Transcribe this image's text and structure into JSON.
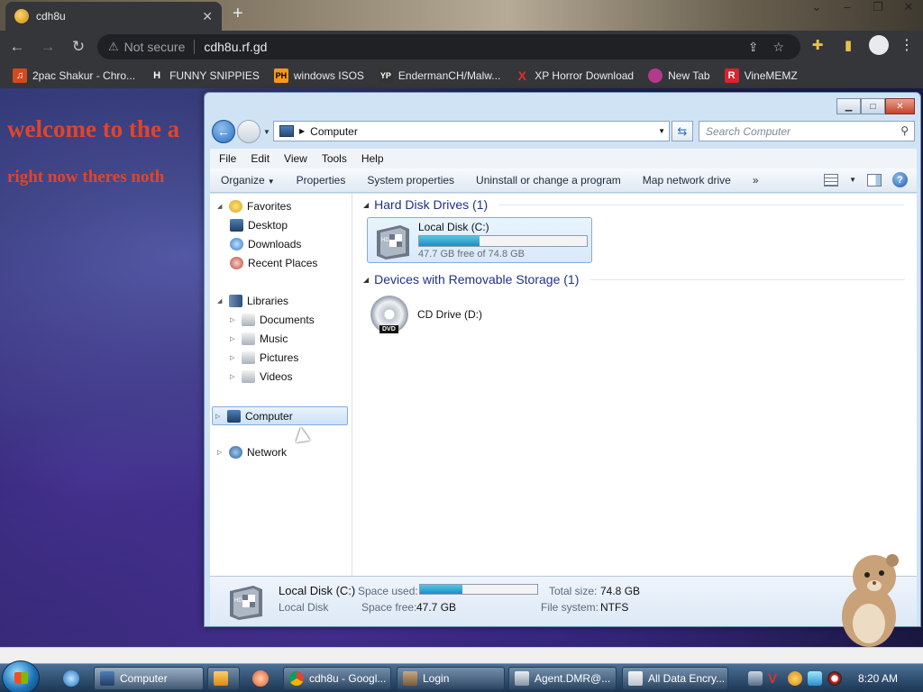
{
  "browser": {
    "tab_title": "cdh8u",
    "tab_close": "✕",
    "new_tab": "+",
    "window_controls": [
      "⌄",
      "–",
      "❐",
      "✕"
    ],
    "security_label": "Not secure",
    "url": "cdh8u.rf.gd",
    "bookmarks": [
      {
        "label": "2pac Shakur - Chro...",
        "icon": "music-icon",
        "color": "#d24a1e"
      },
      {
        "label": "FUNNY SNIPPIES",
        "icon": "h-icon",
        "color": "#ffffff"
      },
      {
        "label": "windows ISOS",
        "icon": "ph-icon",
        "color": "#f7971d"
      },
      {
        "label": "EndermanCH/Malw...",
        "icon": "yp-icon",
        "color": "#333333"
      },
      {
        "label": "XP Horror Download",
        "icon": "x-icon",
        "color": "#e0302a"
      },
      {
        "label": "New Tab",
        "icon": "globe-icon",
        "color": "#b33a8a"
      },
      {
        "label": "VineMEMZ",
        "icon": "r-icon",
        "color": "#d9232e"
      }
    ]
  },
  "page": {
    "heading": "welcome to the a",
    "subheading": "right now theres noth"
  },
  "explorer": {
    "address_crumb": "Computer",
    "search_placeholder": "Search Computer",
    "menu": [
      "File",
      "Edit",
      "View",
      "Tools",
      "Help"
    ],
    "commands": [
      "Organize",
      "Properties",
      "System properties",
      "Uninstall or change a program",
      "Map network drive",
      "»"
    ],
    "nav": {
      "favorites": "Favorites",
      "desktop": "Desktop",
      "downloads": "Downloads",
      "recent_places": "Recent Places",
      "libraries": "Libraries",
      "documents": "Documents",
      "music": "Music",
      "pictures": "Pictures",
      "videos": "Videos",
      "computer": "Computer",
      "network": "Network"
    },
    "groups": {
      "hard_disks": "Hard Disk Drives (1)",
      "removable": "Devices with Removable Storage (1)"
    },
    "local_disk": {
      "name": "Local Disk (C:)",
      "free_text": "47.7 GB free of 74.8 GB",
      "used_fraction": 0.362
    },
    "cd_drive": {
      "name": "CD Drive (D:)",
      "badge": "DVD"
    },
    "details": {
      "name": "Local Disk (C:)",
      "type": "Local Disk",
      "space_used_label": "Space used:",
      "space_free_label": "Space free:",
      "space_free_value": "47.7 GB",
      "total_size_label": "Total size:",
      "total_size_value": "74.8 GB",
      "file_system_label": "File system:",
      "file_system_value": "NTFS",
      "used_fraction": 0.362
    }
  },
  "taskbar": {
    "tasks": [
      {
        "label": "Computer",
        "active": true
      },
      {
        "label": "",
        "active": false
      },
      {
        "label": "cdh8u - Googl...",
        "active": false
      },
      {
        "label": "Login",
        "active": false
      },
      {
        "label": "Agent.DMR@...",
        "active": false
      },
      {
        "label": "All Data Encry...",
        "active": false
      }
    ],
    "clock": "8:20 AM"
  }
}
